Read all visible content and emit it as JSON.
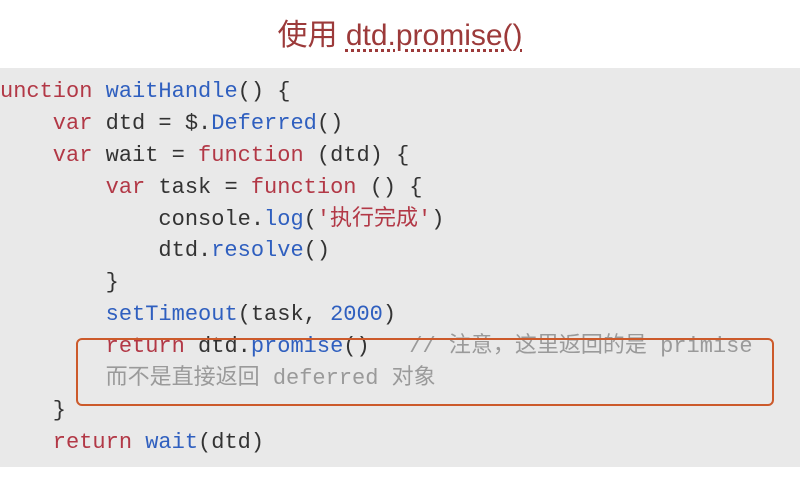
{
  "title": {
    "prefix": "使用 ",
    "highlight": "dtd.promise()"
  },
  "code": {
    "l1_kw": "unction ",
    "l1_fn": "waitHandle",
    "l1_tail": "() {",
    "l2_kw": "    var ",
    "l2_id": "dtd",
    "l2_eq": " = $.",
    "l2_fn": "Deferred",
    "l2_tail": "()",
    "l3_kw": "    var ",
    "l3_id": "wait",
    "l3_eq": " = ",
    "l3_fn": "function ",
    "l3_tail": "(dtd) {",
    "l4_kw": "        var ",
    "l4_id": "task",
    "l4_eq": " = ",
    "l4_fn": "function ",
    "l4_tail": "() {",
    "l5_pre": "            console.",
    "l5_fn": "log",
    "l5_open": "(",
    "l5_str": "'执行完成'",
    "l5_close": ")",
    "l6_pre": "            dtd.",
    "l6_fn": "resolve",
    "l6_tail": "()",
    "l7": "        }",
    "l8_pre": "        ",
    "l8_fn": "setTimeout",
    "l8_open": "(",
    "l8_arg1": "task",
    "l8_comma": ", ",
    "l8_num": "2000",
    "l8_close": ")",
    "l9_kw": "        return ",
    "l9_expr": "dtd.",
    "l9_fn": "promise",
    "l9_tail": "()   ",
    "l9_cm": "// 注意，这里返回的是 primise",
    "l10_cm": "        而不是直接返回 deferred 对象",
    "l11": "    }",
    "l12_kw": "    return ",
    "l12_fn": "wait",
    "l12_tail": "(dtd)"
  }
}
